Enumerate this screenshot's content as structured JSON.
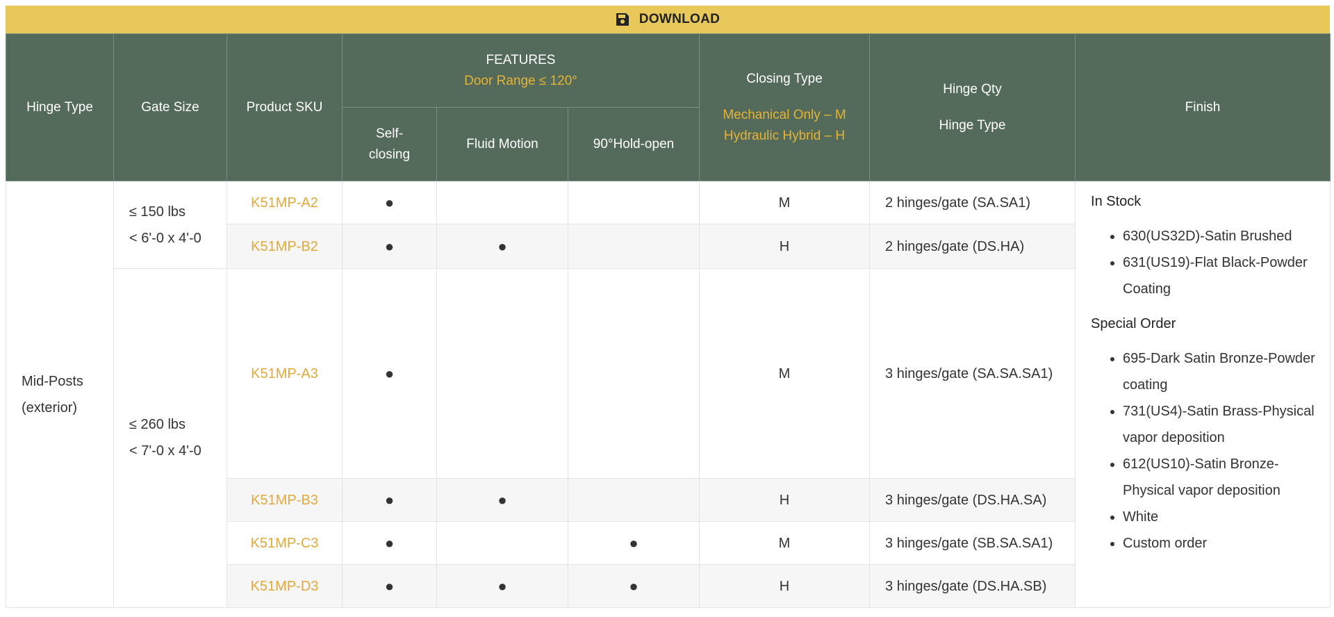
{
  "download": {
    "label": "DOWNLOAD",
    "icon": "floppy-disk-icon",
    "bg_color": "#e8c85a"
  },
  "header": {
    "hinge_type": "Hinge Type",
    "gate_size": "Gate Size",
    "product_sku": "Product SKU",
    "features": "FEATURES",
    "door_range": "Door Range ≤ 120°",
    "self_closing": "Self-\nclosing",
    "fluid_motion": "Fluid Motion",
    "hold_open": "90°Hold-open",
    "closing_type": "Closing Type",
    "closing_m": "Mechanical Only – M",
    "closing_h": "Hydraulic Hybrid – H",
    "hinge_qty": "Hinge Qty",
    "hinge_type2": "Hinge Type",
    "finish": "Finish",
    "bg_color": "#546b5c",
    "accent_color": "#e5b434"
  },
  "rows": {
    "hinge_type_value": "Mid-Posts (exterior)",
    "gate_small_weight": "≤ 150 lbs",
    "gate_small_size": "< 6'-0 x 4'-0",
    "gate_large_weight": "≤ 260 lbs",
    "gate_large_size": "< 7'-0 x 4'-0",
    "items": [
      {
        "sku": "K51MP-A2",
        "self": "●",
        "fluid": "",
        "hold": "",
        "closing": "M",
        "qty": "2 hinges/gate (SA.SA1)"
      },
      {
        "sku": "K51MP-B2",
        "self": "●",
        "fluid": "●",
        "hold": "",
        "closing": "H",
        "qty": "2 hinges/gate (DS.HA)"
      },
      {
        "sku": "K51MP-A3",
        "self": "●",
        "fluid": "",
        "hold": "",
        "closing": "M",
        "qty": "3 hinges/gate (SA.SA.SA1)"
      },
      {
        "sku": "K51MP-B3",
        "self": "●",
        "fluid": "●",
        "hold": "",
        "closing": "H",
        "qty": "3 hinges/gate (DS.HA.SA)"
      },
      {
        "sku": "K51MP-C3",
        "self": "●",
        "fluid": "",
        "hold": "●",
        "closing": "M",
        "qty": "3 hinges/gate (SB.SA.SA1)"
      },
      {
        "sku": "K51MP-D3",
        "self": "●",
        "fluid": "●",
        "hold": "●",
        "closing": "H",
        "qty": "3 hinges/gate (DS.HA.SB)"
      }
    ]
  },
  "finish": {
    "in_stock_title": "In Stock",
    "in_stock": [
      "630(US32D)-Satin Brushed",
      "631(US19)-Flat Black-Powder Coating"
    ],
    "special_title": "Special Order",
    "special": [
      "695-Dark Satin Bronze-Powder coating",
      "731(US4)-Satin Brass-Physical vapor deposition",
      "612(US10)-Satin Bronze-Physical vapor deposition",
      "White",
      "Custom order"
    ]
  }
}
